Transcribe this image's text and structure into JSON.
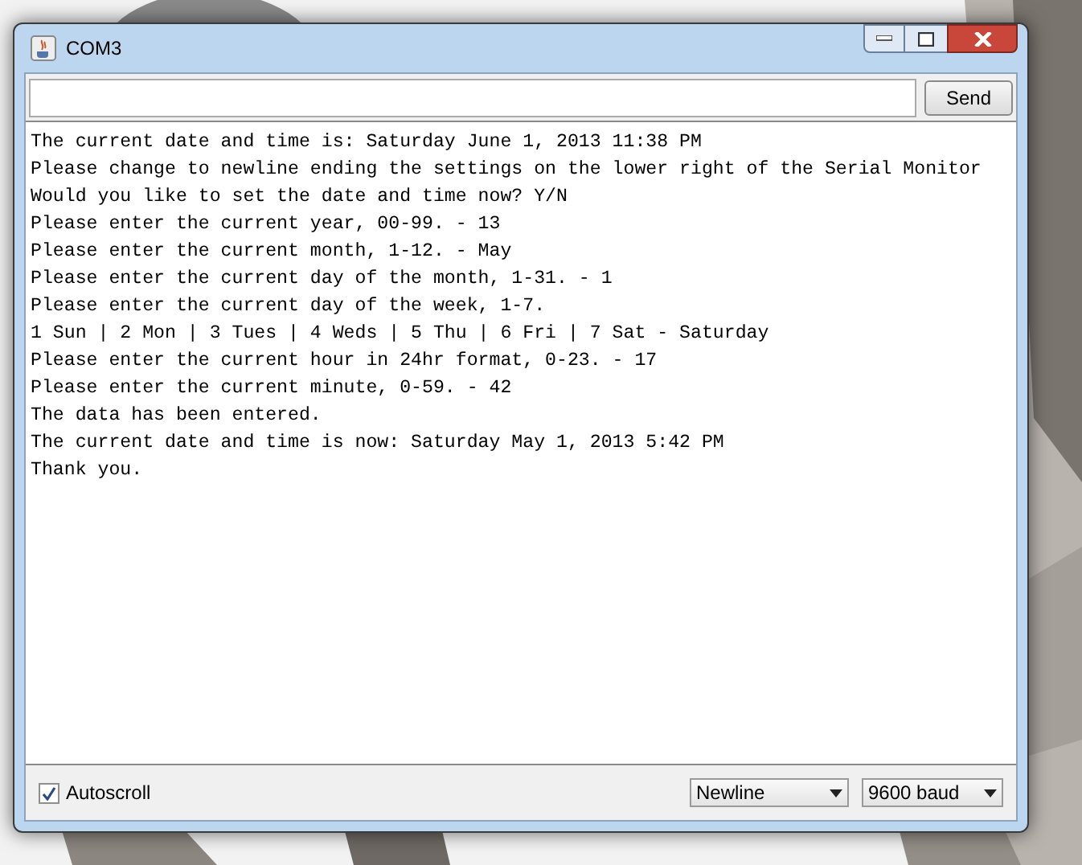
{
  "window": {
    "title": "COM3"
  },
  "send_button": {
    "label": "Send"
  },
  "output": {
    "lines": [
      "The current date and time is: Saturday June 1, 2013 11:38 PM",
      "Please change to newline ending the settings on the lower right of the Serial Monitor",
      "Would you like to set the date and time now? Y/N",
      "Please enter the current year, 00-99. - 13",
      "Please enter the current month, 1-12. - May",
      "Please enter the current day of the month, 1-31. - 1",
      "Please enter the current day of the week, 1-7.",
      "1 Sun | 2 Mon | 3 Tues | 4 Weds | 5 Thu | 6 Fri | 7 Sat - Saturday",
      "Please enter the current hour in 24hr format, 0-23. - 17",
      "Please enter the current minute, 0-59. - 42",
      "The data has been entered.",
      "The current date and time is now: Saturday May 1, 2013 5:42 PM",
      "Thank you."
    ]
  },
  "autoscroll": {
    "label": "Autoscroll",
    "checked": true
  },
  "line_ending": {
    "value": "Newline"
  },
  "baud_rate": {
    "value": "9600 baud"
  }
}
